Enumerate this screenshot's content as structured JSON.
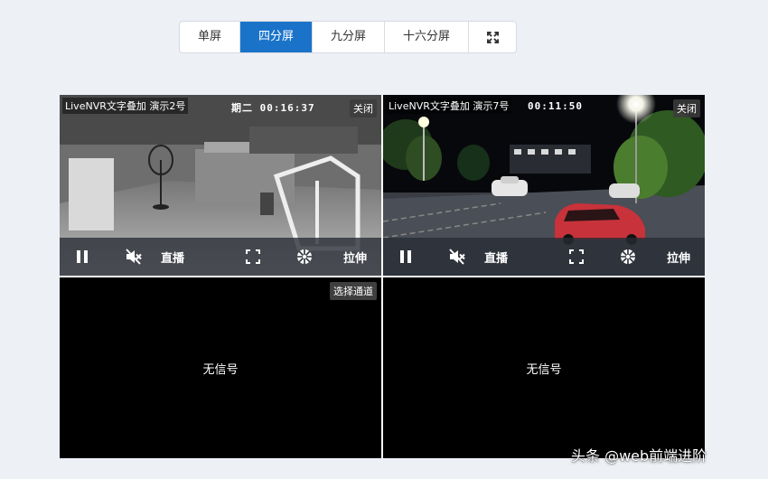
{
  "layout_tabs": [
    {
      "label": "单屏",
      "active": false
    },
    {
      "label": "四分屏",
      "active": true
    },
    {
      "label": "九分屏",
      "active": false
    },
    {
      "label": "十六分屏",
      "active": false
    }
  ],
  "fullscreen_icon": "fullscreen-expand-icon",
  "players": [
    {
      "title": "LiveNVR文字叠加 演示2号",
      "osd": "期二 00:16:37",
      "close_label": "关闭",
      "live_label": "直播",
      "stretch_label": "拉伸"
    },
    {
      "title": "LiveNVR文字叠加 演示7号",
      "osd": "00:11:50",
      "close_label": "关闭",
      "live_label": "直播",
      "stretch_label": "拉伸"
    }
  ],
  "empty_slots": [
    {
      "message": "无信号",
      "select_label": "选择通道"
    },
    {
      "message": "无信号"
    }
  ],
  "icons": {
    "pause": "pause-icon",
    "mute": "muted-speaker-icon",
    "fullscreen": "fullscreen-icon",
    "snapshot": "camera-shutter-icon"
  },
  "colors": {
    "accent": "#1a73c9",
    "background": "#edf0f5"
  },
  "watermark": "头条 @web前端进阶"
}
